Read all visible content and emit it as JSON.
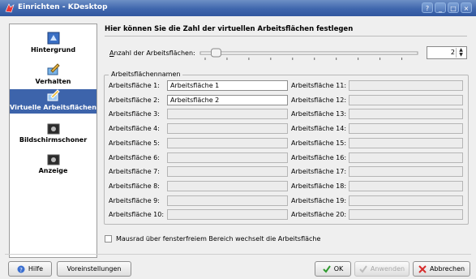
{
  "window": {
    "title": "Einrichten - KDesktop",
    "buttons": [
      "?",
      "_",
      "□",
      "×"
    ]
  },
  "sidebar": {
    "items": [
      {
        "label": "Hintergrund",
        "icon": "background-icon"
      },
      {
        "label": "Verhalten",
        "icon": "behavior-icon"
      },
      {
        "label": "Virtuelle Arbeitsflächen",
        "icon": "virtual-desktops-icon",
        "active": true
      },
      {
        "label": "Bildschirmschoner",
        "icon": "screensaver-icon"
      },
      {
        "label": "Anzeige",
        "icon": "display-icon"
      }
    ]
  },
  "main": {
    "heading": "Hier können Sie die Zahl der virtuellen Arbeitsflächen festlegen",
    "count_label": "Anzahl der Arbeitsflächen:",
    "count_value": "2",
    "slider_min": 1,
    "slider_max": 20,
    "slider_value": 2,
    "names_group_label": "Arbeitsflächennamen",
    "rows": [
      {
        "label": "Arbeitsfläche 1:",
        "value": "Arbeitsfläche 1",
        "enabled": true
      },
      {
        "label": "Arbeitsfläche 2:",
        "value": "Arbeitsfläche 2",
        "enabled": true
      },
      {
        "label": "Arbeitsfläche 3:",
        "value": "",
        "enabled": false
      },
      {
        "label": "Arbeitsfläche 4:",
        "value": "",
        "enabled": false
      },
      {
        "label": "Arbeitsfläche 5:",
        "value": "",
        "enabled": false
      },
      {
        "label": "Arbeitsfläche 6:",
        "value": "",
        "enabled": false
      },
      {
        "label": "Arbeitsfläche 7:",
        "value": "",
        "enabled": false
      },
      {
        "label": "Arbeitsfläche 8:",
        "value": "",
        "enabled": false
      },
      {
        "label": "Arbeitsfläche 9:",
        "value": "",
        "enabled": false
      },
      {
        "label": "Arbeitsfläche 10:",
        "value": "",
        "enabled": false
      },
      {
        "label": "Arbeitsfläche 11:",
        "value": "",
        "enabled": false
      },
      {
        "label": "Arbeitsfläche 12:",
        "value": "",
        "enabled": false
      },
      {
        "label": "Arbeitsfläche 13:",
        "value": "",
        "enabled": false
      },
      {
        "label": "Arbeitsfläche 14:",
        "value": "",
        "enabled": false
      },
      {
        "label": "Arbeitsfläche 15:",
        "value": "",
        "enabled": false
      },
      {
        "label": "Arbeitsfläche 16:",
        "value": "",
        "enabled": false
      },
      {
        "label": "Arbeitsfläche 17:",
        "value": "",
        "enabled": false
      },
      {
        "label": "Arbeitsfläche 18:",
        "value": "",
        "enabled": false
      },
      {
        "label": "Arbeitsfläche 19:",
        "value": "",
        "enabled": false
      },
      {
        "label": "Arbeitsfläche 20:",
        "value": "",
        "enabled": false
      }
    ],
    "mousewheel_label": "Mausrad über fensterfreiem Bereich wechselt die Arbeitsfläche",
    "mousewheel_checked": false
  },
  "footer": {
    "help_label": "Hilfe",
    "defaults_label": "Voreinstellungen",
    "ok_label": "OK",
    "apply_label": "Anwenden",
    "cancel_label": "Abbrechen"
  }
}
